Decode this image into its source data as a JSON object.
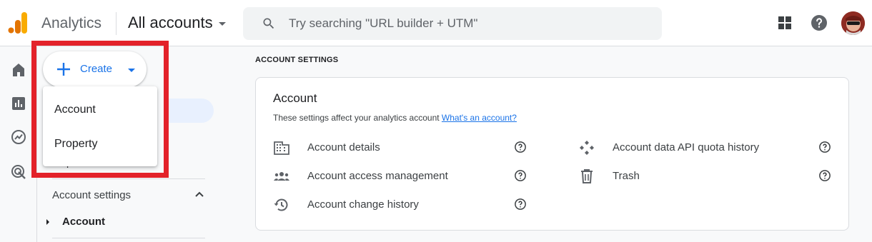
{
  "header": {
    "app_name": "Analytics",
    "account_switcher": "All accounts",
    "search_placeholder": "Try searching \"URL builder + UTM\""
  },
  "sidebar": {
    "create_label": "Create",
    "partial_item": "p",
    "account_settings_label": "Account settings",
    "tree_item": "Account"
  },
  "create_menu": {
    "items": [
      "Account",
      "Property"
    ]
  },
  "main": {
    "section_heading": "ACCOUNT SETTINGS",
    "card": {
      "title": "Account",
      "description": "These settings affect your analytics account",
      "link": "What's an account?",
      "rows": [
        {
          "label": "Account details",
          "icon": "building-icon"
        },
        {
          "label": "Account access management",
          "icon": "people-icon"
        },
        {
          "label": "Account change history",
          "icon": "history-icon"
        },
        {
          "label": "Account data API quota history",
          "icon": "api-diamond-icon"
        },
        {
          "label": "Trash",
          "icon": "trash-icon"
        }
      ]
    }
  },
  "colors": {
    "accent": "#1a73e8",
    "highlight_box": "#e3222a",
    "logo_orange": "#f9ab00",
    "logo_dark_orange": "#e37400"
  }
}
